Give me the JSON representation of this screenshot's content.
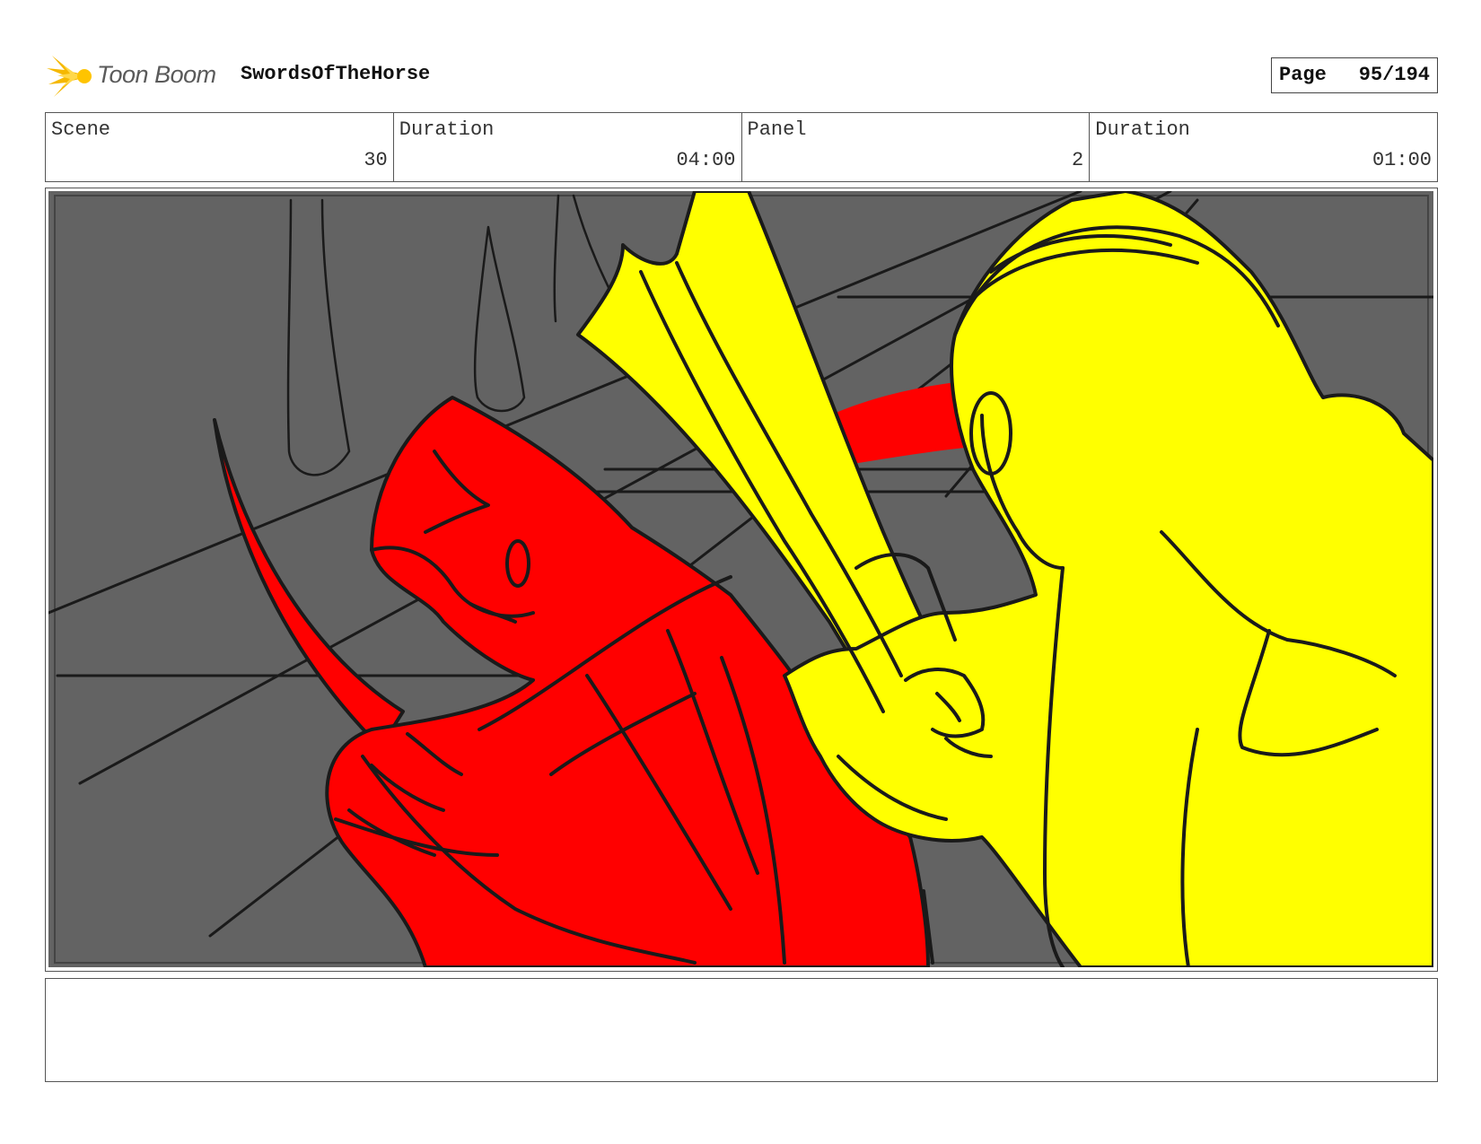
{
  "header": {
    "logo_text": "Toon Boom",
    "project_title": "SwordsOfTheHorse",
    "page_label": "Page",
    "page_number": "95/194"
  },
  "info": {
    "scene_label": "Scene",
    "scene_value": "30",
    "scene_duration_label": "Duration",
    "scene_duration_value": "04:00",
    "panel_label": "Panel",
    "panel_value": "2",
    "panel_duration_label": "Duration",
    "panel_duration_value": "01:00"
  },
  "colors": {
    "background_gray": "#636363",
    "figure_red": "#ff0000",
    "figure_yellow": "#ffff00",
    "line": "#1a1a1a",
    "logo_flame": "#f5b800"
  },
  "notes": {
    "text": ""
  }
}
